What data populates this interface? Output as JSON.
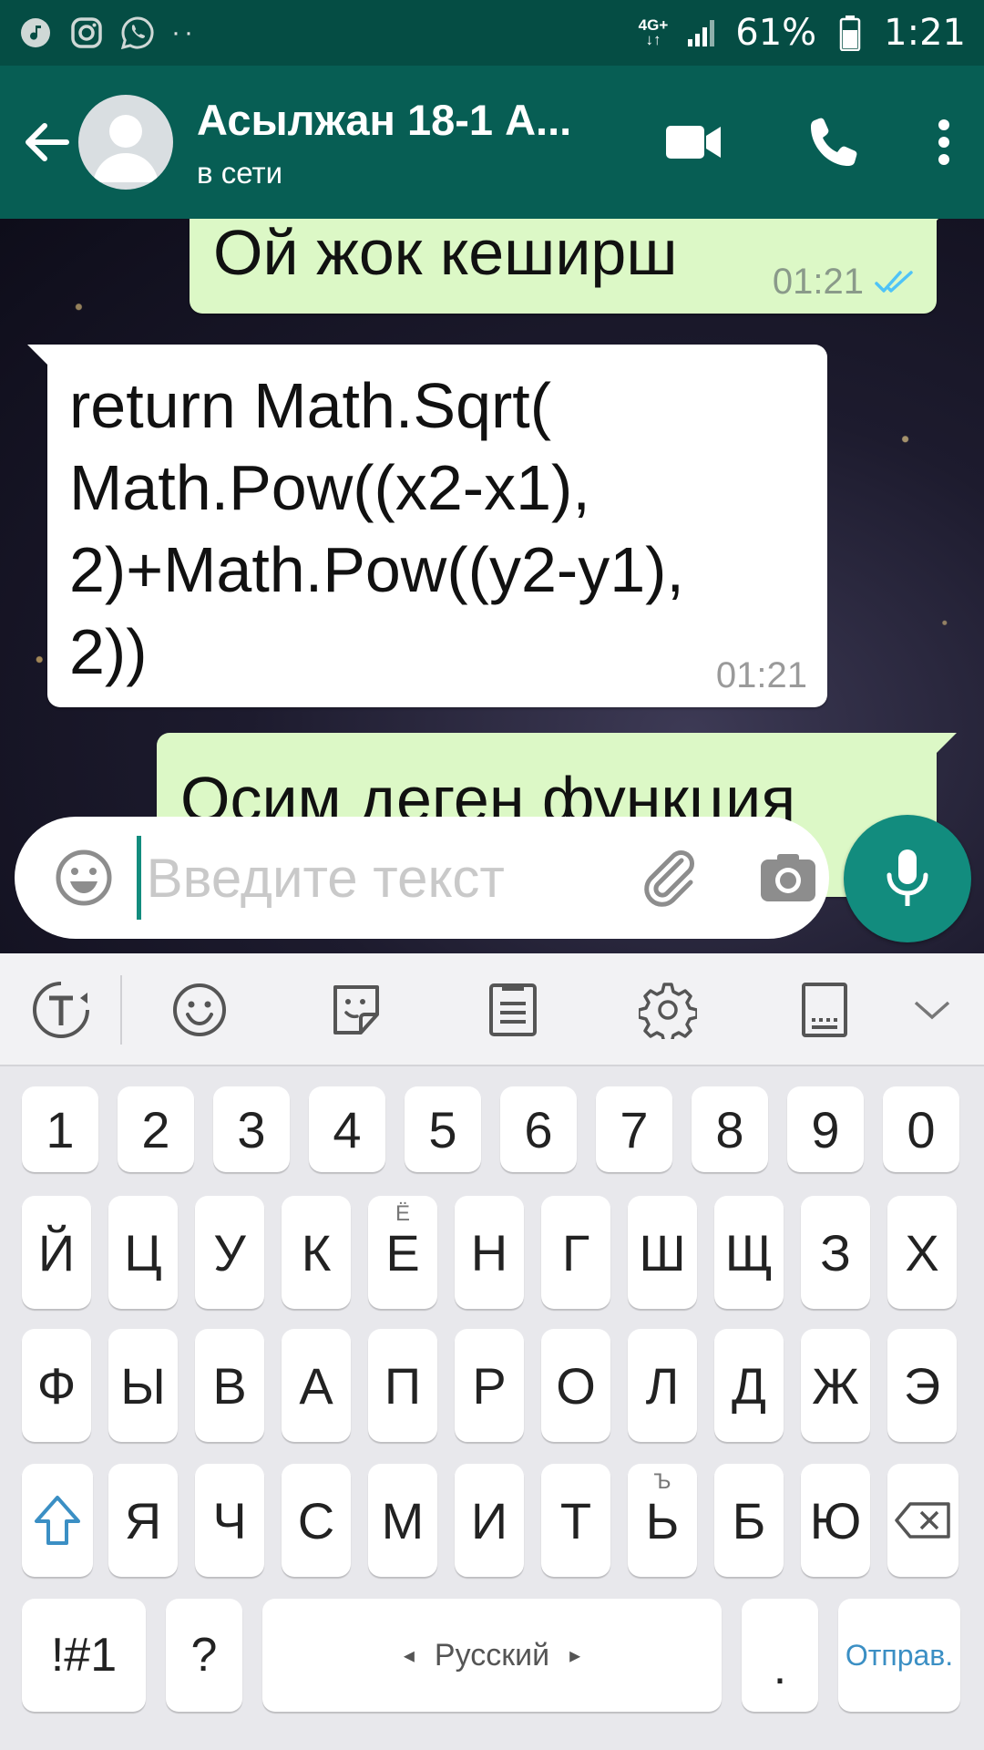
{
  "status_bar": {
    "left_icons": [
      "music-icon",
      "instagram-icon",
      "whatsapp-icon"
    ],
    "dots": "··",
    "network_top": "4G+",
    "network_bottom": "↓↑",
    "battery_percent": "61%",
    "time": "1:21"
  },
  "header": {
    "title": "Асылжан 18-1 А...",
    "subtitle": "в сети"
  },
  "messages": [
    {
      "direction": "out",
      "text": "Ой жок кеширш",
      "time": "01:21",
      "status": "read"
    },
    {
      "direction": "in",
      "text": "return Math.Sqrt(\nMath.Pow((x2-x1),\n2)+Math.Pow((y2-y1),\n2))",
      "time": "01:21"
    },
    {
      "direction": "out",
      "text": "Осим деген функция"
    }
  ],
  "input": {
    "placeholder": "Введите текст",
    "value": ""
  },
  "keyboard": {
    "numbers": [
      "1",
      "2",
      "3",
      "4",
      "5",
      "6",
      "7",
      "8",
      "9",
      "0"
    ],
    "row1": [
      "Й",
      "Ц",
      "У",
      "К",
      "Е",
      "Н",
      "Г",
      "Ш",
      "Щ",
      "З",
      "Х"
    ],
    "row1_alt": {
      "4": "Ё"
    },
    "row2": [
      "Ф",
      "Ы",
      "В",
      "А",
      "П",
      "Р",
      "О",
      "Л",
      "Д",
      "Ж",
      "Э"
    ],
    "row3": [
      "Я",
      "Ч",
      "С",
      "М",
      "И",
      "Т",
      "Ь",
      "Б",
      "Ю"
    ],
    "row3_alt": {
      "6": "Ъ"
    },
    "symbols_key": "!#1",
    "question_key": "?",
    "space_label": "Русский",
    "period_key": ".",
    "send_key": "Отправ."
  },
  "colors": {
    "status_bar": "#054d44",
    "header": "#075e54",
    "outgoing_bubble": "#dcf8c6",
    "accent": "#128c7e",
    "read_ticks": "#4fc3f7",
    "send_key": "#3b8fc4"
  }
}
